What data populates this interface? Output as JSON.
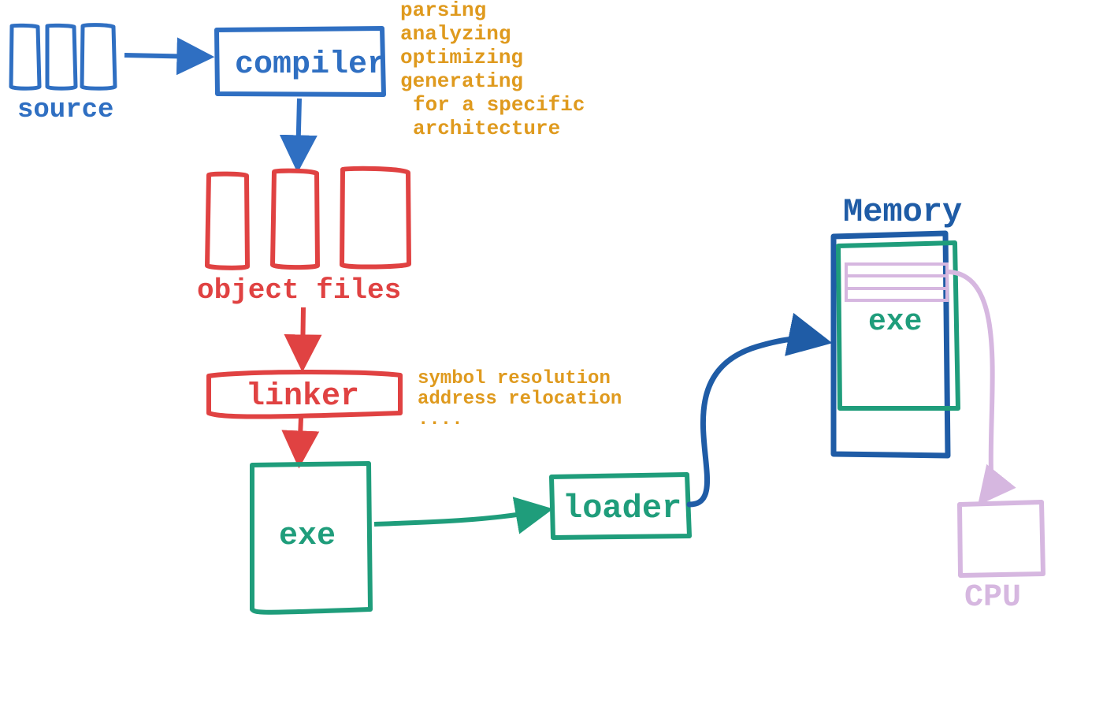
{
  "colors": {
    "blue": "#2f6fc2",
    "darkblue": "#1f5ca6",
    "red": "#e04242",
    "orange": "#df9a1e",
    "green": "#1f9d7b",
    "teal": "#1f9d7b",
    "purple": "#d6b7e0"
  },
  "labels": {
    "source": "source",
    "compiler": "compiler",
    "compiler_notes_1": "parsing",
    "compiler_notes_2": "analyzing",
    "compiler_notes_3": "optimizing",
    "compiler_notes_4": "generating",
    "compiler_notes_5": "for a specific",
    "compiler_notes_6": "architecture",
    "object_files": "object files",
    "linker": "linker",
    "linker_notes_1": "symbol resolution",
    "linker_notes_2": "address relocation",
    "linker_notes_3": "....",
    "exe": "exe",
    "loader": "loader",
    "memory": "Memory",
    "exe_mem": "exe",
    "cpu": "CPU"
  }
}
